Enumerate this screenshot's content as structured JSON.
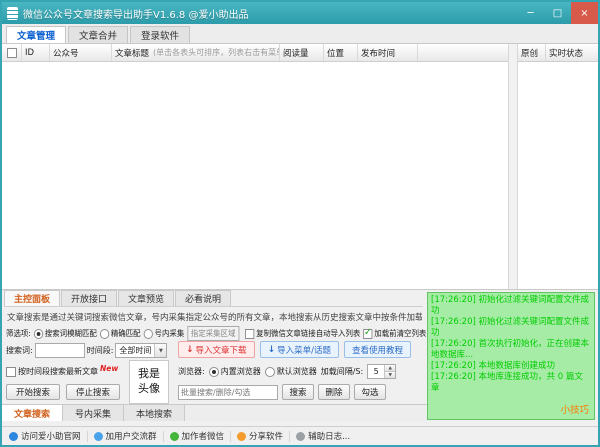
{
  "window": {
    "title": "微信公众号文章搜索导出助手V1.6.8 @爱小助出品",
    "controls": {
      "minimize": "─",
      "maximize": "□",
      "close": "×"
    }
  },
  "icons": {
    "dropdown_arrow": "▼",
    "spinner_up": "▲",
    "spinner_down": "▼",
    "download_arrow": "↓"
  },
  "main_tabs": [
    {
      "label": "文章管理"
    },
    {
      "label": "文章合并"
    },
    {
      "label": "登录软件"
    }
  ],
  "table": {
    "columns": {
      "id": "ID",
      "account": "公众号",
      "title": "文章标题",
      "title_hint": "(单击各表头可排序，列表右击有菜单)",
      "reads": "阅读量",
      "position": "位置",
      "publish_time": "发布时间",
      "original": "原创",
      "status": "实时状态"
    },
    "rows": []
  },
  "panel_tabs": [
    {
      "label": "主控面板"
    },
    {
      "label": "开放接口"
    },
    {
      "label": "文章预览"
    },
    {
      "label": "必看说明"
    }
  ],
  "main_panel": {
    "description": "文章搜索是通过关键词搜索微信文章，号内采集指定公众号的所有文章，本地搜索从历史搜索文章中按条件加载",
    "filters": {
      "label": "筛选项:",
      "fuzzy": "搜索词模糊匹配",
      "exact": "精确匹配",
      "in_account": "号内采集",
      "region": "指定采集区域"
    },
    "search": {
      "keyword_label": "搜索词:",
      "keyword_value": "",
      "time_label": "时间段:",
      "time_value": "全部时间",
      "recent_label": "按时间段搜索最新文章",
      "new_badge": "New",
      "start_btn": "开始搜索",
      "stop_btn": "停止搜索"
    },
    "avatar": {
      "line1": "我是",
      "line2": "头像"
    },
    "import": {
      "copy_link_label": "复制微信文章链接自动导入列表",
      "clear_label": "加载前清空列表",
      "download_btn": "导入文章下载",
      "menu_btn": "导入菜单/话题",
      "tutorial_btn": "查看使用教程"
    },
    "browser": {
      "label": "浏览器:",
      "builtin": "内置浏览器",
      "system": "默认浏览器",
      "interval_label": "加载间隔/S:",
      "interval_value": "5"
    },
    "batch": {
      "placeholder": "批量搜索/删除/勾选",
      "search_btn": "搜索",
      "delete_btn": "删除",
      "check_btn": "勾选"
    }
  },
  "sub_tabs": [
    {
      "label": "文章搜索"
    },
    {
      "label": "号内采集"
    },
    {
      "label": "本地搜索"
    }
  ],
  "log": {
    "messages": [
      "[17:26:20] 初始化过滤关键词配置文件成功",
      "[17:26:20] 初始化过滤关键词配置文件成功",
      "[17:26:20] 首次执行初始化，正在创建本地数据库...",
      "[17:26:20] 本地数据库创建成功",
      "[17:26:20] 本地库连接成功，共 0 篇文章"
    ],
    "tip": "小技巧"
  },
  "statusbar": {
    "items": [
      {
        "icon": "globe-icon",
        "label": "访问爱小助官网"
      },
      {
        "icon": "users-icon",
        "label": "加用户交流群"
      },
      {
        "icon": "wechat-icon",
        "label": "加作者微信"
      },
      {
        "icon": "share-icon",
        "label": "分享软件"
      },
      {
        "icon": "log-icon",
        "label": "辅助日志..."
      }
    ]
  },
  "colors": {
    "titlebar_teal": "#35A5B3",
    "tab_selected_blue": "#0A5FD0",
    "panel_tab_orange": "#D2611E",
    "log_bg": "#A6ECA6",
    "log_text": "#00CC00",
    "tip_orange": "#FF7A00",
    "danger_red": "#E03232",
    "link_blue": "#2B6BC4"
  }
}
